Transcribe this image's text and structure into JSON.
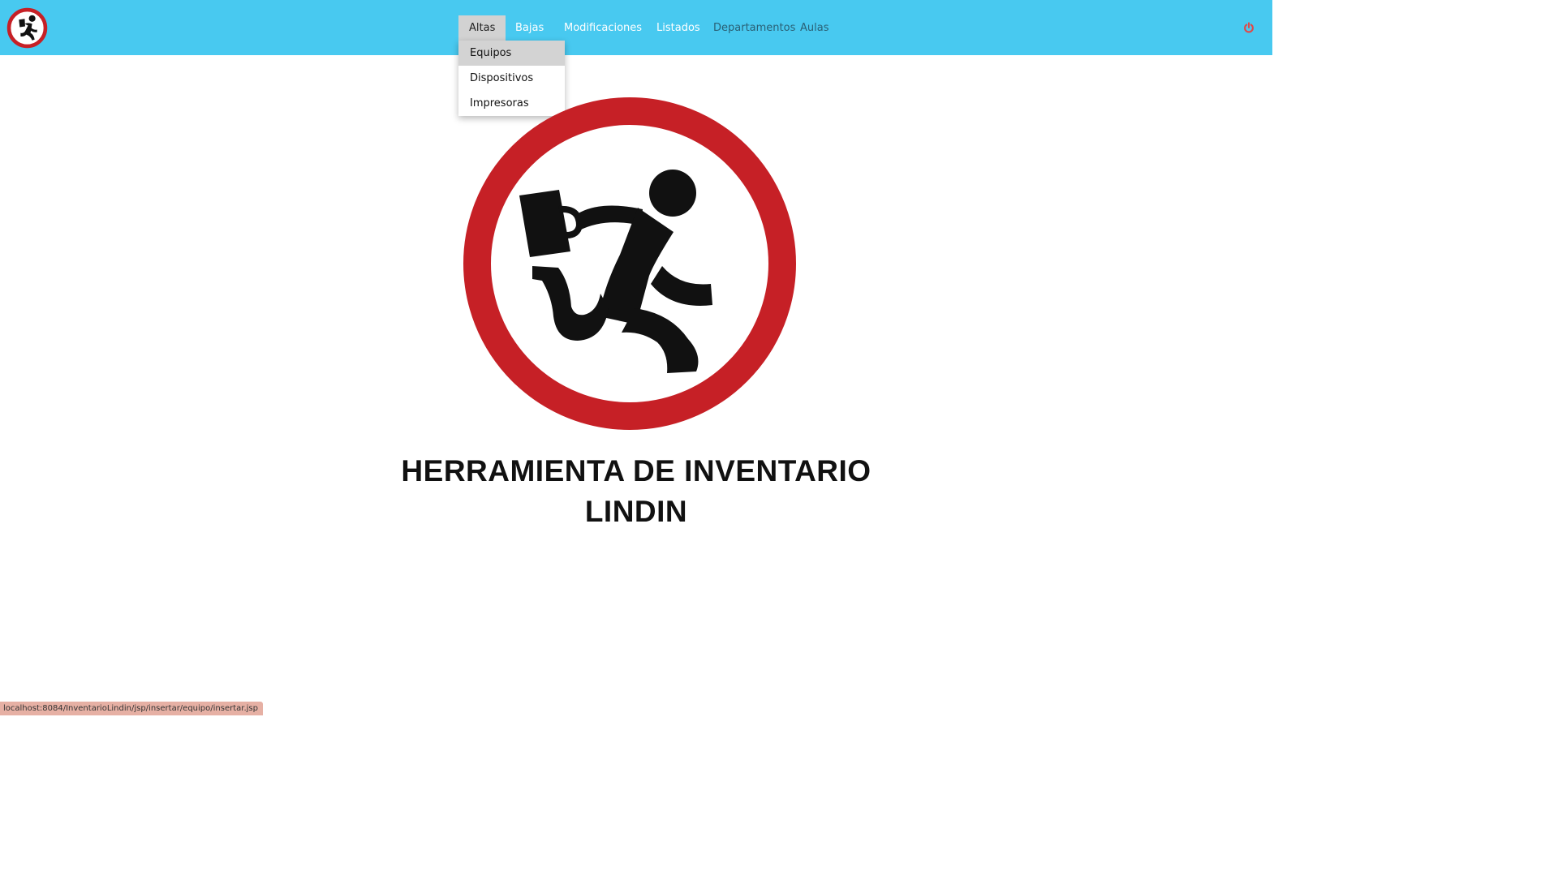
{
  "navbar": {
    "brand_logo": "running-man-logo",
    "items": [
      {
        "label": "Altas",
        "state": "active"
      },
      {
        "label": "Bajas"
      },
      {
        "label": "Modificaciones"
      },
      {
        "label": "Listados"
      },
      {
        "label": "Departamentos"
      },
      {
        "label": "Aulas"
      }
    ],
    "power_icon": "power-icon",
    "colors": {
      "navbar_bg": "#48c9f0",
      "active_item_bg": "#d2d2d2",
      "logo_red": "#c62026"
    }
  },
  "dropdown": {
    "items": [
      {
        "label": "Equipos",
        "state": "hover"
      },
      {
        "label": "Dispositivos"
      },
      {
        "label": "Impresoras"
      }
    ]
  },
  "hero": {
    "logo": "running-man-logo",
    "title_line1": "HERRAMIENTA DE INVENTARIO",
    "title_line2": "LINDIN"
  },
  "status_bar": {
    "url": "localhost:8084/InventarioLindin/jsp/insertar/equipo/insertar.jsp"
  }
}
